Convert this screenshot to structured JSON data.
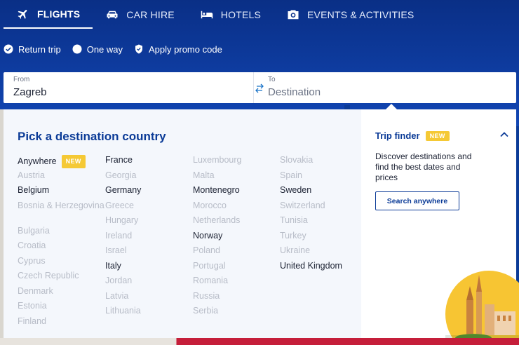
{
  "nav": {
    "tabs": [
      {
        "label": "FLIGHTS",
        "icon": "plane-icon",
        "active": true
      },
      {
        "label": "CAR HIRE",
        "icon": "car-icon",
        "active": false
      },
      {
        "label": "HOTELS",
        "icon": "bed-icon",
        "active": false
      },
      {
        "label": "EVENTS & ACTIVITIES",
        "icon": "camera-icon",
        "active": false
      }
    ]
  },
  "trip_options": {
    "return_trip": "Return trip",
    "one_way": "One way",
    "promo": "Apply promo code",
    "selected": "Return trip"
  },
  "search": {
    "from_label": "From",
    "from_value": "Zagreb",
    "to_label": "To",
    "to_placeholder": "Destination"
  },
  "picker": {
    "title": "Pick a destination country",
    "new_badge": "NEW",
    "columns": [
      [
        {
          "name": "Anywhere",
          "available": true,
          "badge": true
        },
        {
          "name": "Austria",
          "available": false
        },
        {
          "name": "Belgium",
          "available": true
        },
        {
          "name": "Bosnia & Herzegovina",
          "available": false,
          "two_line": true
        },
        {
          "name": "Bulgaria",
          "available": false
        },
        {
          "name": "Croatia",
          "available": false
        },
        {
          "name": "Cyprus",
          "available": false
        },
        {
          "name": "Czech Republic",
          "available": false
        },
        {
          "name": "Denmark",
          "available": false
        },
        {
          "name": "Estonia",
          "available": false
        },
        {
          "name": "Finland",
          "available": false
        }
      ],
      [
        {
          "name": "France",
          "available": true
        },
        {
          "name": "Georgia",
          "available": false
        },
        {
          "name": "Germany",
          "available": true
        },
        {
          "name": "Greece",
          "available": false
        },
        {
          "name": "Hungary",
          "available": false
        },
        {
          "name": "Ireland",
          "available": false
        },
        {
          "name": "Israel",
          "available": false
        },
        {
          "name": "Italy",
          "available": true
        },
        {
          "name": "Jordan",
          "available": false
        },
        {
          "name": "Latvia",
          "available": false
        },
        {
          "name": "Lithuania",
          "available": false
        }
      ],
      [
        {
          "name": "Luxembourg",
          "available": false
        },
        {
          "name": "Malta",
          "available": false
        },
        {
          "name": "Montenegro",
          "available": true
        },
        {
          "name": "Morocco",
          "available": false
        },
        {
          "name": "Netherlands",
          "available": false
        },
        {
          "name": "Norway",
          "available": true
        },
        {
          "name": "Poland",
          "available": false
        },
        {
          "name": "Portugal",
          "available": false
        },
        {
          "name": "Romania",
          "available": false
        },
        {
          "name": "Russia",
          "available": false
        },
        {
          "name": "Serbia",
          "available": false
        }
      ],
      [
        {
          "name": "Slovakia",
          "available": false
        },
        {
          "name": "Spain",
          "available": false
        },
        {
          "name": "Sweden",
          "available": true
        },
        {
          "name": "Switzerland",
          "available": false
        },
        {
          "name": "Tunisia",
          "available": false
        },
        {
          "name": "Turkey",
          "available": false
        },
        {
          "name": "Ukraine",
          "available": false
        },
        {
          "name": "United Kingdom",
          "available": true
        }
      ]
    ]
  },
  "trip_finder": {
    "title": "Trip finder",
    "badge": "NEW",
    "description": "Discover destinations and find the best dates and prices",
    "button": "Search anywhere"
  },
  "colors": {
    "brand_blue": "#0b3b97",
    "badge_yellow": "#f5c935",
    "unavailable_text": "#b7bcc7"
  }
}
